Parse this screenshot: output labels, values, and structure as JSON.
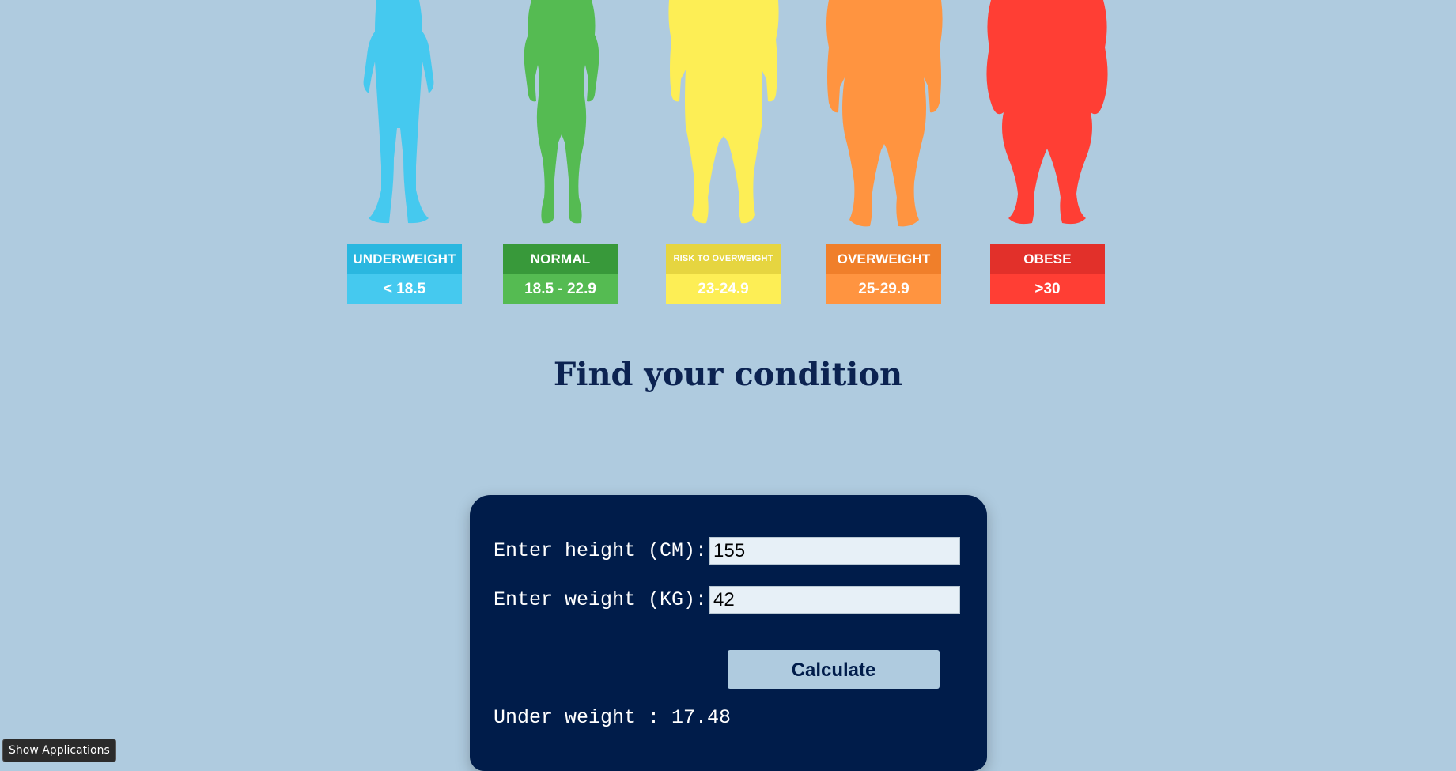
{
  "categories": [
    {
      "name": "UNDERWEIGHT",
      "range": "< 18.5",
      "color": "#45c9ef",
      "dark": "#2ab7e0"
    },
    {
      "name": "NORMAL",
      "range": "18.5 - 22.9",
      "color": "#55bb52",
      "dark": "#38993a"
    },
    {
      "name": "RISK TO OVERWEIGHT",
      "range": "23-24.9",
      "color": "#fdee55",
      "dark": "#e6d540"
    },
    {
      "name": "OVERWEIGHT",
      "range": "25-29.9",
      "color": "#ff9440",
      "dark": "#f07f2a"
    },
    {
      "name": "OBESE",
      "range": ">30",
      "color": "#ff3e34",
      "dark": "#e2302a"
    }
  ],
  "heading": "Find your condition",
  "form": {
    "height_label": "Enter height (CM):",
    "height_value": "155",
    "weight_label": "Enter weight (KG):",
    "weight_value": "42",
    "button_label": "Calculate",
    "result": "Under weight : 17.48"
  },
  "taskbar": {
    "show_apps_label": "Show Applications"
  }
}
